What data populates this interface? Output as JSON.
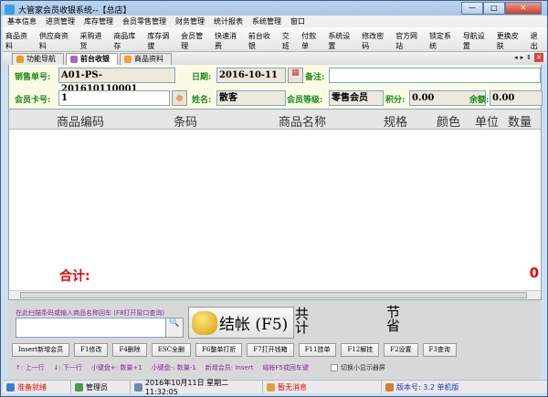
{
  "window": {
    "title": "大管家会员收银系统--【总店】",
    "min": "—",
    "max": "□",
    "close": "✕"
  },
  "menu": [
    "基本信息",
    "进货管理",
    "库存管理",
    "会员零售管理",
    "财务管理",
    "统计报表",
    "系统管理",
    "窗口"
  ],
  "toolbar": [
    {
      "label": "商品资料",
      "icon": "product-icon",
      "color": "#f0a030"
    },
    {
      "label": "供应商资料",
      "icon": "supplier-icon",
      "color": "#c07040"
    },
    {
      "label": "采购进货",
      "icon": "purchase-icon",
      "color": "#7090c0"
    },
    {
      "label": "商品库存",
      "icon": "inventory-icon",
      "color": "#e0a020"
    },
    {
      "label": "库存调拔",
      "icon": "transfer-icon",
      "color": "#d03030"
    },
    {
      "label": "会员管理",
      "icon": "member-icon",
      "color": "#60a0e0"
    },
    {
      "label": "快速消费",
      "icon": "quick-consume-icon",
      "color": "#e0b040"
    },
    {
      "label": "前台收银",
      "icon": "cashier-icon",
      "color": "#b060c0"
    },
    {
      "label": "交班",
      "icon": "shift-icon",
      "color": "#c08040"
    },
    {
      "label": "付款单",
      "icon": "payment-icon",
      "color": "#60b060"
    },
    {
      "label": "系统设置",
      "icon": "settings-icon",
      "color": "#d09020"
    },
    {
      "label": "修改密码",
      "icon": "key-icon",
      "color": "#e0c060"
    },
    {
      "label": "官方网站",
      "icon": "ie-icon",
      "color": "#3080e0"
    },
    {
      "label": "锁定系统",
      "icon": "lock-icon",
      "color": "#5070c0"
    },
    {
      "label": "导航设置",
      "icon": "nav-settings-icon",
      "color": "#909090"
    },
    {
      "label": "更换皮肤",
      "icon": "skin-icon",
      "color": "#c040a0"
    },
    {
      "label": "退出",
      "icon": "exit-icon",
      "color": "#d04040"
    }
  ],
  "tabs": [
    {
      "label": "功能导航",
      "color": "#e0a020"
    },
    {
      "label": "前台收银",
      "color": "#b060c0",
      "active": true
    },
    {
      "label": "商品资料",
      "color": "#f0a030"
    }
  ],
  "tab_controls": {
    "prev": "◂",
    "next": "▸",
    "pin": "⇕",
    "close": "✕"
  },
  "form": {
    "order_no_label": "销售单号:",
    "order_no": "A01-PS-201610110001",
    "date_label": "日期:",
    "date": "2016-10-11",
    "note_label": "备注:",
    "note": "",
    "card_label": "会员卡号:",
    "card": "1",
    "name_label": "姓名:",
    "name": "散客",
    "level_label": "会员等级:",
    "level": "零售会员",
    "points_label": "积分:",
    "points": "0.00",
    "balance_label": "余额:",
    "balance": "0.00"
  },
  "grid": {
    "columns": [
      "商品编码",
      "条码",
      "商品名称",
      "规格",
      "颜色",
      "单位",
      "数量"
    ],
    "rows": [],
    "total_label": "合计:",
    "total_value": "0"
  },
  "bottom": {
    "scan_hint": "在此扫描条码或输入商品名称回车 (F8打开窗口查询)",
    "scan_value": "",
    "checkout_label": "结帐 (F5)",
    "sum_label": "共计",
    "save_label": "节省",
    "keys": [
      "Insert新增会员",
      "F1修改",
      "F4删除",
      "ESC全删",
      "F6整单打折",
      "F7打开钱箱",
      "F11挂单",
      "F12解挂",
      "F2设置",
      "F3查询"
    ],
    "tips": [
      "↑: 上一行",
      "↓: 下一行",
      "小键盘+: 数量+1",
      "小键盘-: 数量-1",
      "新增会员: Insert",
      "结帐F5或回车键"
    ],
    "toggle_label": "切换小显示器屏",
    "toggle_checked": false
  },
  "status": {
    "ready": "准备就绪",
    "user": "管理员",
    "datetime": "2016年10月11日 星期二    11:32:05",
    "message": "暂无消息",
    "version": "版本号: 3.2 单机版"
  }
}
